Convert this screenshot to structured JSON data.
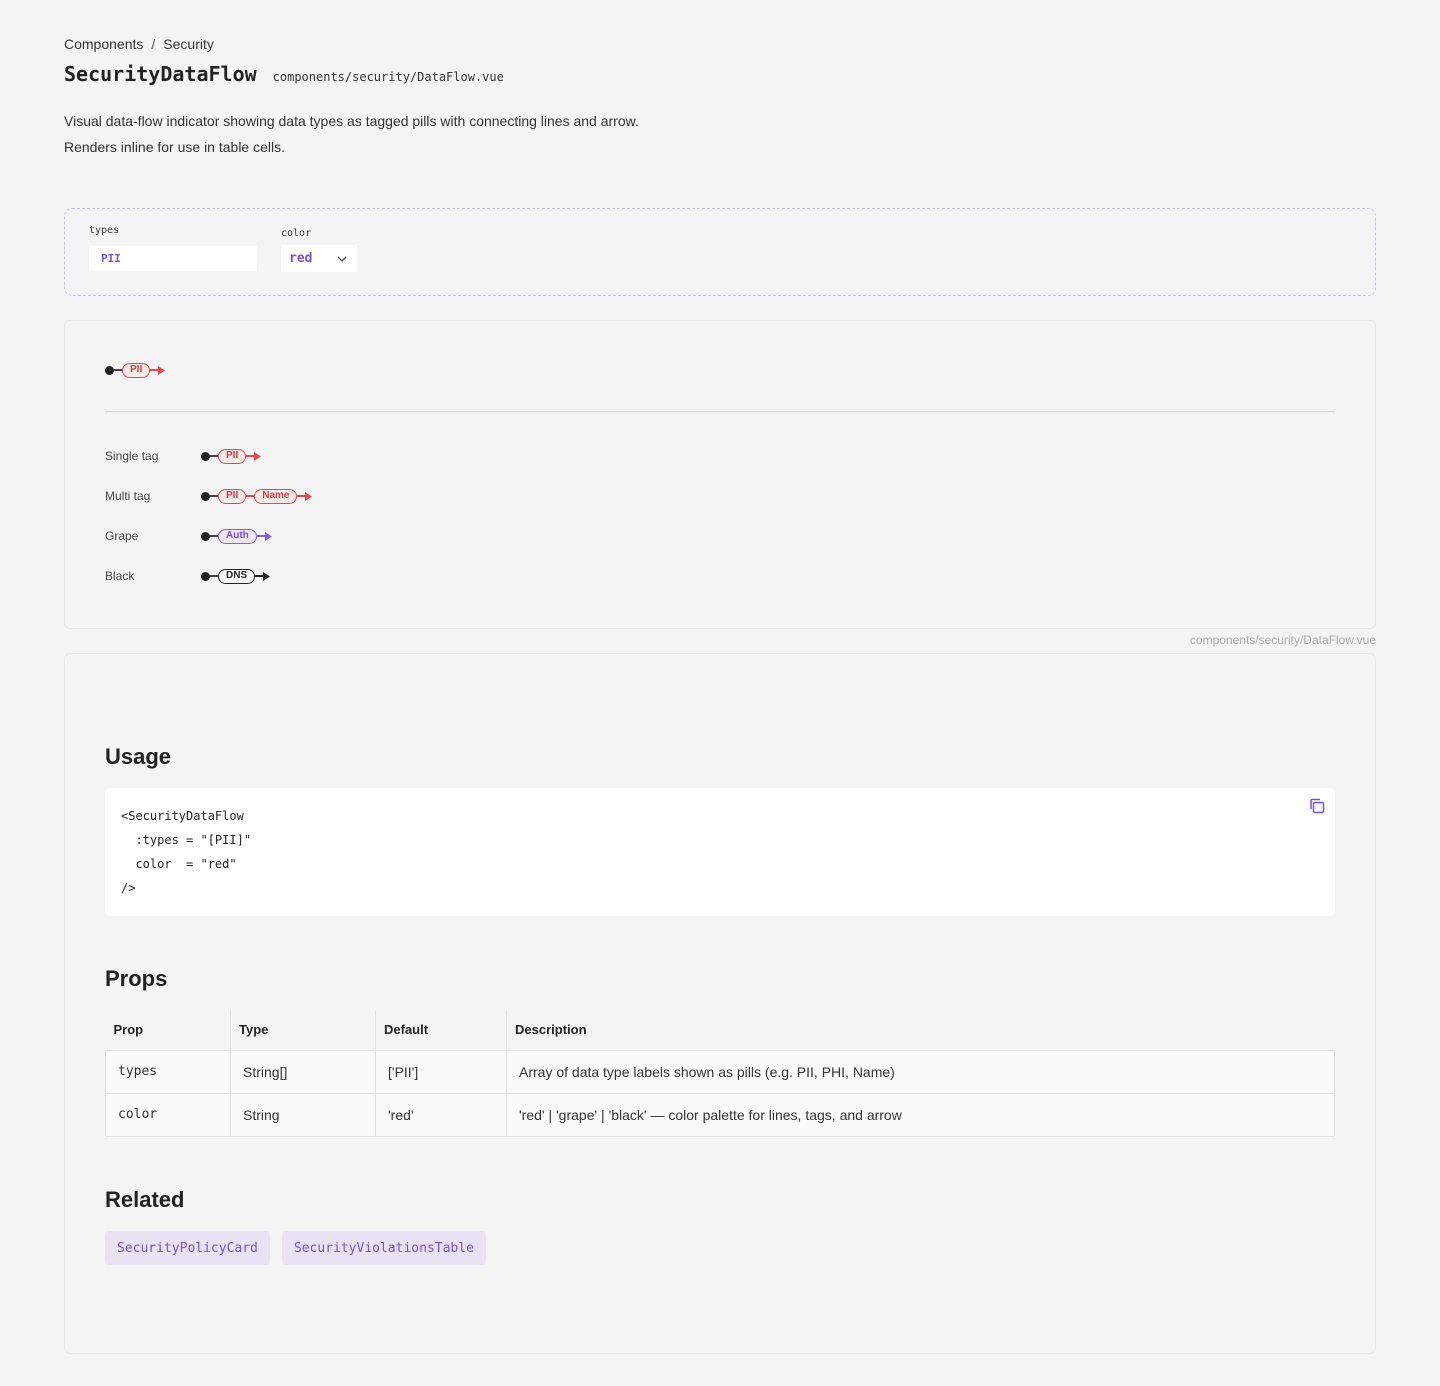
{
  "breadcrumb": {
    "parent": "Components",
    "separator": "/",
    "current": "Security"
  },
  "header": {
    "title": "SecurityDataFlow",
    "file_path": "components/security/DataFlow.vue",
    "description": "Visual data-flow indicator showing data types as tagged pills with connecting lines and arrow. Renders inline for use in table cells."
  },
  "controls": {
    "types_label": "types",
    "types_value": "PII",
    "color_label": "color",
    "color_value": "red"
  },
  "preview": {
    "main": {
      "color": "red",
      "tags": [
        "PII"
      ]
    },
    "variants": [
      {
        "label": "Single tag",
        "color": "red",
        "tags": [
          "PII"
        ]
      },
      {
        "label": "Multi tag",
        "color": "red",
        "tags": [
          "PII",
          "Name"
        ]
      },
      {
        "label": "Grape",
        "color": "grape",
        "tags": [
          "Auth"
        ]
      },
      {
        "label": "Black",
        "color": "black",
        "tags": [
          "DNS"
        ]
      }
    ]
  },
  "caption": "components/security/DataFlow.vue",
  "usage": {
    "heading": "Usage",
    "code_lines": [
      "<SecurityDataFlow",
      "  :types = \"[PII]\"",
      "  color  = \"red\"",
      "/>"
    ]
  },
  "props": {
    "heading": "Props",
    "columns": [
      "Prop",
      "Type",
      "Default",
      "Description"
    ],
    "rows": [
      {
        "prop": "types",
        "type": "String[]",
        "default": "['PII']",
        "description": "Array of data type labels shown as pills (e.g. PII, PHI, Name)"
      },
      {
        "prop": "color",
        "type": "String",
        "default": "'red'",
        "description": "'red' | 'grape' | 'black' — color palette for lines, tags, and arrow"
      }
    ]
  },
  "related": {
    "heading": "Related",
    "items": [
      "SecurityPolicyCard",
      "SecurityViolationsTable"
    ]
  },
  "colors": {
    "accent": "#7b4fd6",
    "red": "#e24a4a",
    "grape": "#8a5ce0",
    "black": "#222222"
  }
}
